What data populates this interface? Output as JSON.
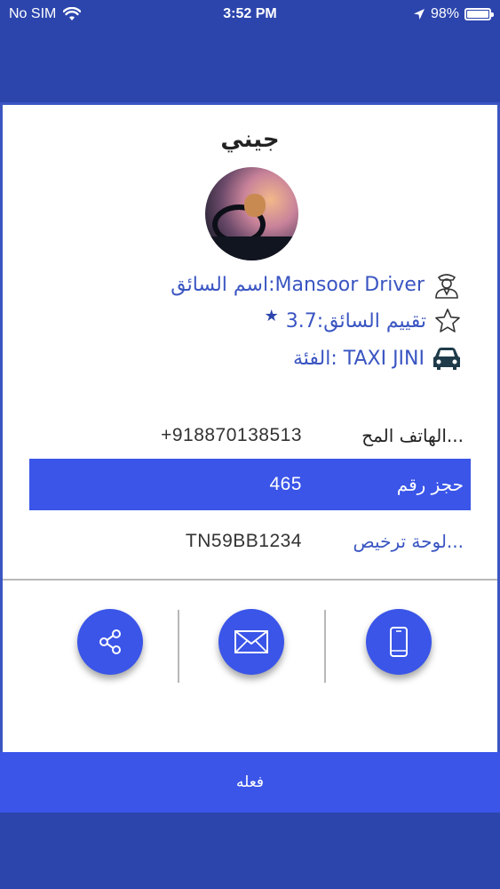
{
  "status_bar": {
    "carrier": "No SIM",
    "time": "3:52 PM",
    "battery": "98%",
    "battery_level": 0.98
  },
  "card": {
    "title": "جيني",
    "driver_name": "اسم السائق:Mansoor Driver",
    "driver_rating": "تقييم السائق:3.7",
    "category": "الفئة:  TAXI JINI",
    "details": {
      "phone_label": "الهاتف المح...",
      "phone_value": "+918870138513",
      "booking_label": "حجز رقم",
      "booking_value": "465",
      "plate_label": "لوحة ترخيص...",
      "plate_value": "TN59BB1234"
    }
  },
  "actions": {
    "buttons": [
      "call-button",
      "message-button",
      "share-button"
    ]
  },
  "footer": {
    "action_label": "فعله"
  },
  "colors": {
    "primary_dark": "#2c45ad",
    "primary": "#3a55e8",
    "link_text": "#3a55c2"
  }
}
